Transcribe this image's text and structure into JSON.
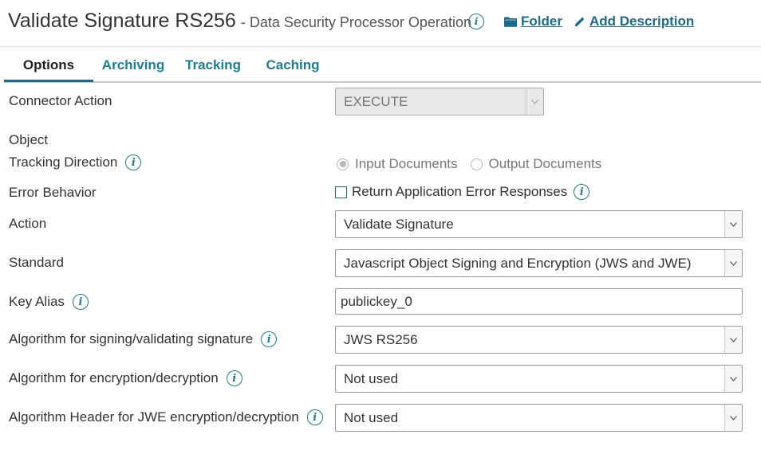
{
  "header": {
    "title": "Validate Signature RS256",
    "subtitle": "- Data Security Processor Operation",
    "info_icon": "info-icon",
    "folder_label": "Folder",
    "folder_icon": "folder-icon",
    "add_description_label": "Add Description",
    "add_description_icon": "pencil-icon"
  },
  "tabs": [
    {
      "label": "Options",
      "active": true
    },
    {
      "label": "Archiving",
      "active": false
    },
    {
      "label": "Tracking",
      "active": false
    },
    {
      "label": "Caching",
      "active": false
    }
  ],
  "form": {
    "connector_action": {
      "label": "Connector Action",
      "value": "EXECUTE",
      "disabled": true
    },
    "object": {
      "label": "Object"
    },
    "tracking_direction": {
      "label": "Tracking Direction",
      "options": [
        "Input Documents",
        "Output Documents"
      ],
      "selected": "Input Documents"
    },
    "error_behavior": {
      "label": "Error Behavior",
      "checkbox_label": "Return Application Error Responses",
      "checked": false
    },
    "action": {
      "label": "Action",
      "value": "Validate Signature"
    },
    "standard": {
      "label": "Standard",
      "value": "Javascript Object Signing and Encryption (JWS and JWE)"
    },
    "key_alias": {
      "label": "Key Alias",
      "value": "publickey_0"
    },
    "algorithm_signing": {
      "label": "Algorithm for signing/validating signature",
      "value": "JWS RS256"
    },
    "algorithm_encryption": {
      "label": "Algorithm for encryption/decryption",
      "value": "Not used"
    },
    "algorithm_header_jwe": {
      "label": "Algorithm Header for JWE encryption/decryption",
      "value": "Not used"
    }
  },
  "colors": {
    "accent": "#1a7f91",
    "link": "#1a6c8a",
    "text": "#333333"
  }
}
